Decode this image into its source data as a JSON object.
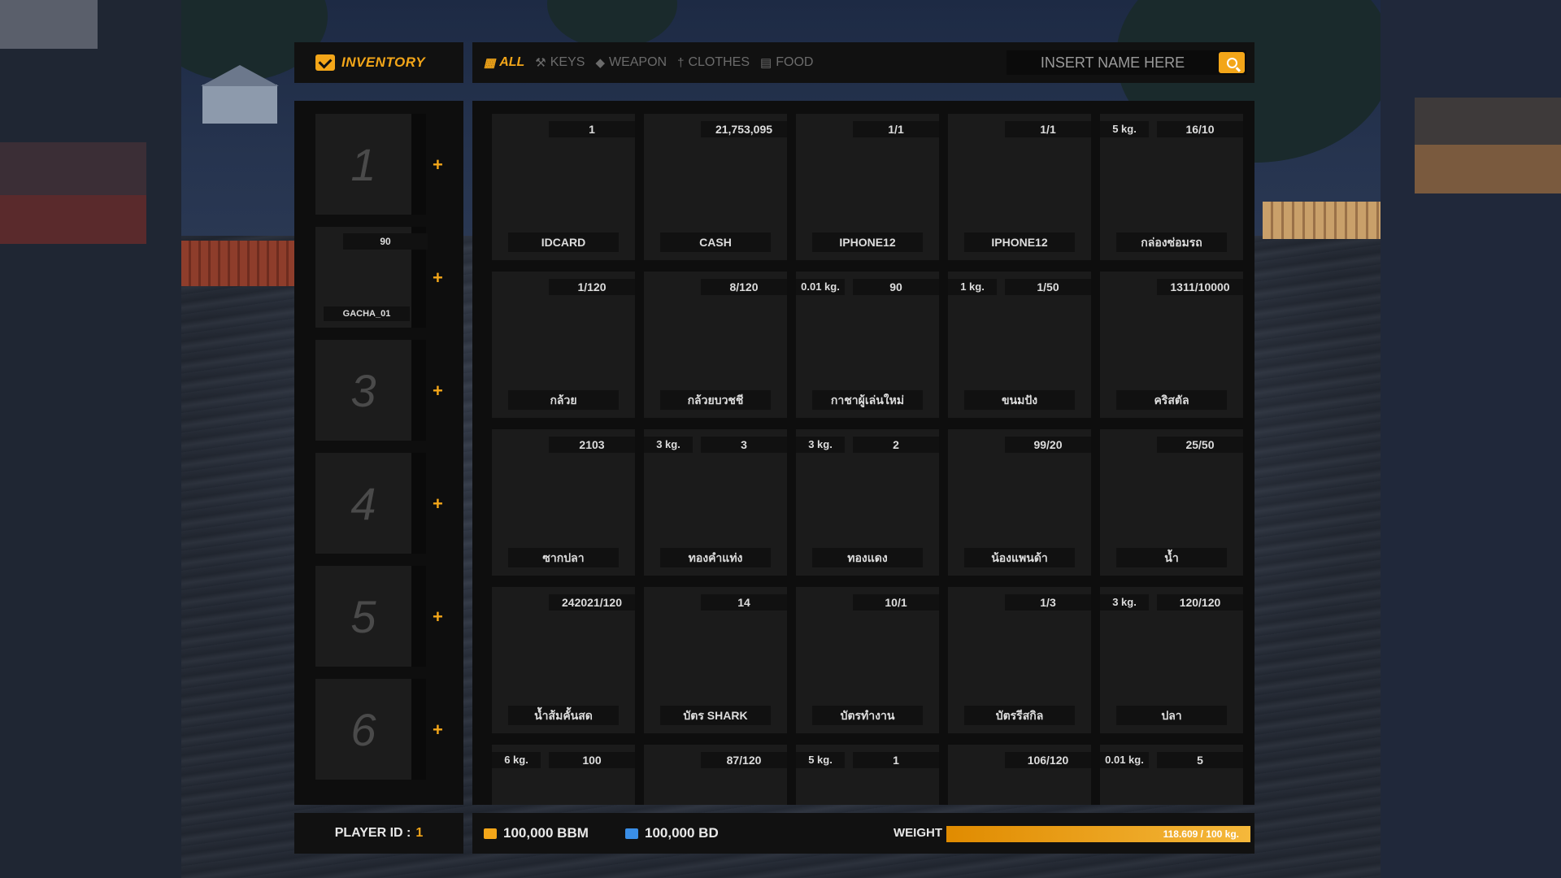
{
  "header": {
    "title": "INVENTORY"
  },
  "tabs": [
    {
      "label": "ALL",
      "icon": "grid-icon",
      "active": true
    },
    {
      "label": "KEYS",
      "icon": "key-icon",
      "active": false
    },
    {
      "label": "WEAPON",
      "icon": "shield-icon",
      "active": false
    },
    {
      "label": "CLOTHES",
      "icon": "person-icon",
      "active": false
    },
    {
      "label": "FOOD",
      "icon": "food-can-icon",
      "active": false
    }
  ],
  "search": {
    "placeholder": "INSERT NAME HERE"
  },
  "hotbar": [
    {
      "slot": "1",
      "count": "",
      "name": ""
    },
    {
      "slot": "",
      "count": "90",
      "name": "GACHA_01"
    },
    {
      "slot": "3",
      "count": "",
      "name": ""
    },
    {
      "slot": "4",
      "count": "",
      "name": ""
    },
    {
      "slot": "5",
      "count": "",
      "name": ""
    },
    {
      "slot": "6",
      "count": "",
      "name": ""
    }
  ],
  "items": [
    {
      "weight": "",
      "count": "1",
      "name": "IDCARD"
    },
    {
      "weight": "",
      "count": "21,753,095",
      "name": "CASH"
    },
    {
      "weight": "",
      "count": "1/1",
      "name": "IPHONE12"
    },
    {
      "weight": "",
      "count": "1/1",
      "name": "IPHONE12"
    },
    {
      "weight": "5 kg.",
      "count": "16/10",
      "name": "กล่องซ่อมรถ"
    },
    {
      "weight": "",
      "count": "1/120",
      "name": "กล้วย"
    },
    {
      "weight": "",
      "count": "8/120",
      "name": "กล้วยบวชชี"
    },
    {
      "weight": "0.01 kg.",
      "count": "90",
      "name": "กาชาผู้เล่นใหม่"
    },
    {
      "weight": "1 kg.",
      "count": "1/50",
      "name": "ขนมปัง"
    },
    {
      "weight": "",
      "count": "1311/10000",
      "name": "คริสตัล"
    },
    {
      "weight": "",
      "count": "2103",
      "name": "ซากปลา"
    },
    {
      "weight": "3 kg.",
      "count": "3",
      "name": "ทองคำแท่ง"
    },
    {
      "weight": "3 kg.",
      "count": "2",
      "name": "ทองแดง"
    },
    {
      "weight": "",
      "count": "99/20",
      "name": "น้องแพนด้า"
    },
    {
      "weight": "",
      "count": "25/50",
      "name": "น้ำ"
    },
    {
      "weight": "",
      "count": "242021/120",
      "name": "น้ำส้มคั้นสด"
    },
    {
      "weight": "",
      "count": "14",
      "name": "บัตร SHARK"
    },
    {
      "weight": "",
      "count": "10/1",
      "name": "บัตรทำงาน"
    },
    {
      "weight": "",
      "count": "1/3",
      "name": "บัตรรีสกิล"
    },
    {
      "weight": "3 kg.",
      "count": "120/120",
      "name": "ปลา"
    },
    {
      "weight": "6 kg.",
      "count": "100",
      "name": ""
    },
    {
      "weight": "",
      "count": "87/120",
      "name": ""
    },
    {
      "weight": "5 kg.",
      "count": "1",
      "name": ""
    },
    {
      "weight": "",
      "count": "106/120",
      "name": ""
    },
    {
      "weight": "0.01 kg.",
      "count": "5",
      "name": ""
    }
  ],
  "footer": {
    "player_id_label": "PLAYER ID :",
    "player_id": "1",
    "money_bbm": "100,000 BBM",
    "money_bd": "100,000 BD",
    "weight_label": "WEIGHT",
    "weight_text": "118.609 / 100 kg.",
    "weight_fraction": 1.0
  },
  "colors": {
    "accent": "#f3a619",
    "bd_icon": "#3a8ee6",
    "panel": "#111111"
  }
}
